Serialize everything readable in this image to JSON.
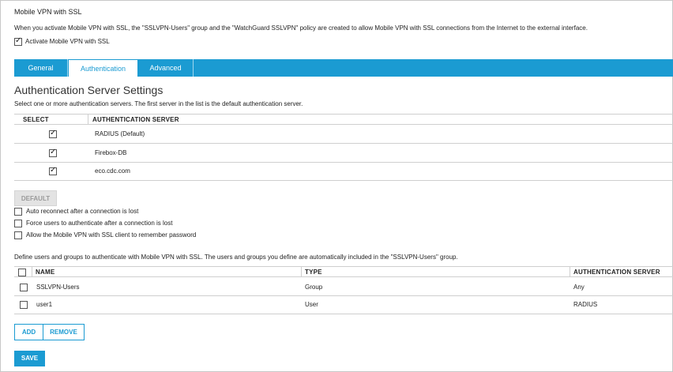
{
  "page": {
    "title": "Mobile VPN with SSL",
    "description": "When you activate Mobile VPN with SSL, the \"SSLVPN-Users\" group and the \"WatchGuard SSLVPN\" policy are created to allow Mobile VPN with SSL connections from the Internet to the external interface.",
    "activate_label": "Activate Mobile VPN with SSL",
    "activate_checked": true
  },
  "tabs": [
    {
      "label": "General",
      "active": false
    },
    {
      "label": "Authentication",
      "active": true
    },
    {
      "label": "Advanced",
      "active": false
    }
  ],
  "auth_section": {
    "heading": "Authentication Server Settings",
    "description": "Select one or more authentication servers. The first server in the list is the default authentication server.",
    "columns": [
      "SELECT",
      "AUTHENTICATION SERVER"
    ],
    "rows": [
      {
        "checked": true,
        "server": "RADIUS (Default)"
      },
      {
        "checked": true,
        "server": "Firebox-DB"
      },
      {
        "checked": true,
        "server": "eco.cdc.com"
      }
    ],
    "default_button": "DEFAULT"
  },
  "options": [
    {
      "label": "Auto reconnect after a connection is lost",
      "checked": false
    },
    {
      "label": "Force users to authenticate after a connection is lost",
      "checked": false
    },
    {
      "label": "Allow the Mobile VPN with SSL client to remember password",
      "checked": false
    }
  ],
  "users_section": {
    "description": "Define users and groups to authenticate with Mobile VPN with SSL. The users and groups you define are automatically included in the \"SSLVPN-Users\" group.",
    "columns": [
      "NAME",
      "TYPE",
      "AUTHENTICATION SERVER"
    ],
    "rows": [
      {
        "checked": false,
        "name": "SSLVPN-Users",
        "type": "Group",
        "server": "Any"
      },
      {
        "checked": false,
        "name": "user1",
        "type": "User",
        "server": "RADIUS"
      }
    ],
    "add_button": "ADD",
    "remove_button": "REMOVE"
  },
  "save_button": "SAVE",
  "colors": {
    "accent": "#1b9bd2",
    "disabled_button": "#e3e3e3"
  }
}
